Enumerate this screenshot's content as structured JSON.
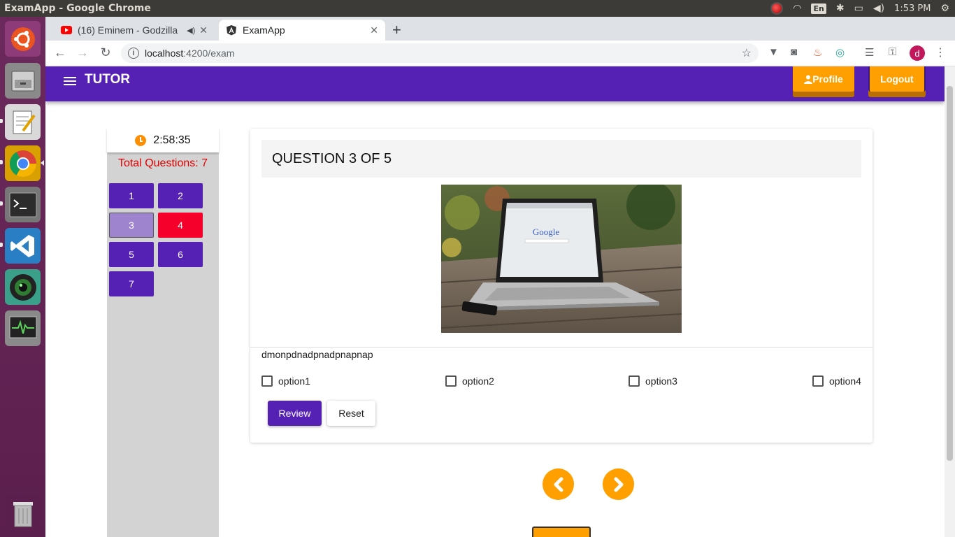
{
  "os": {
    "window_title": "ExamApp - Google Chrome",
    "input_method": "En",
    "clock": "1:53 PM"
  },
  "browser": {
    "tabs": [
      {
        "label": "(16) Eminem - Godzilla",
        "favicon": "youtube-icon"
      },
      {
        "label": "ExamApp",
        "favicon": "angular-icon"
      }
    ],
    "url_host": "localhost",
    "url_path": ":4200/exam",
    "profile_initial": "d"
  },
  "app": {
    "brand": "TUTOR",
    "profile_label": "Profile",
    "logout_label": "Logout",
    "colors": {
      "primary": "#5521b5",
      "accent": "#ffa000",
      "flagged": "#f5002a"
    }
  },
  "sidebar": {
    "timer": "2:58:35",
    "total_questions": "Total Questions: 7",
    "questions": [
      {
        "label": "1",
        "state": "normal"
      },
      {
        "label": "2",
        "state": "normal"
      },
      {
        "label": "3",
        "state": "current"
      },
      {
        "label": "4",
        "state": "flagged"
      },
      {
        "label": "5",
        "state": "normal"
      },
      {
        "label": "6",
        "state": "normal"
      },
      {
        "label": "7",
        "state": "normal"
      }
    ]
  },
  "question": {
    "heading": "QUESTION 3 OF 5",
    "text": "dmonpdnadpnadpnapnap",
    "options": [
      {
        "label": "option1",
        "checked": false
      },
      {
        "label": "option2",
        "checked": false
      },
      {
        "label": "option3",
        "checked": false
      },
      {
        "label": "option4",
        "checked": false
      }
    ],
    "review_label": "Review",
    "reset_label": "Reset"
  },
  "image_illustration": {
    "logo_text": "Google"
  }
}
